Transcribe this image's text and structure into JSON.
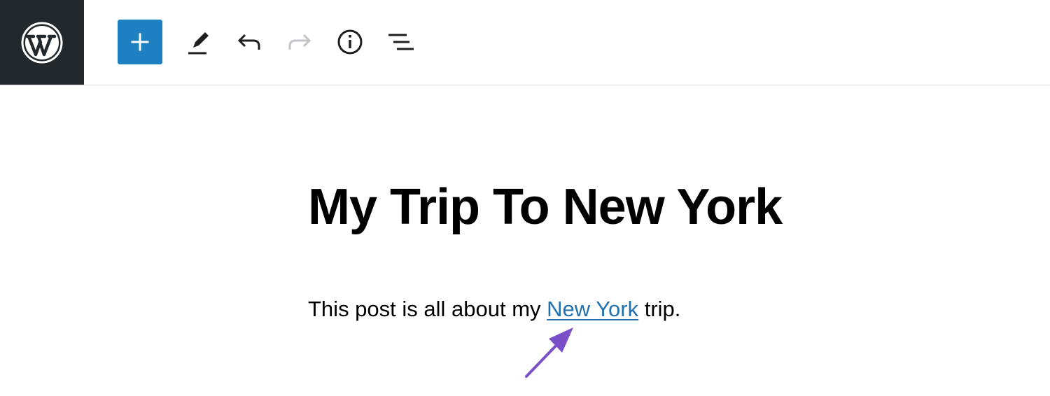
{
  "toolbar": {
    "logo_icon": "wordpress-logo-icon",
    "inserter_icon": "plus-icon",
    "tools": [
      {
        "icon": "pencil-icon"
      },
      {
        "icon": "undo-icon"
      },
      {
        "icon": "redo-icon"
      },
      {
        "icon": "info-icon"
      },
      {
        "icon": "list-view-icon"
      }
    ]
  },
  "post": {
    "title": "My Trip To New York",
    "paragraph_before": "This post is all about my ",
    "link_text": "New York",
    "paragraph_after": " trip."
  },
  "colors": {
    "logo_bg": "#23282d",
    "inserter_bg": "#1e80c1",
    "link": "#2271b1",
    "arrow": "#7b4fc7",
    "redo_disabled": "#c3c4c7"
  },
  "annotation": {
    "arrow_icon": "arrow-pointer-icon"
  }
}
